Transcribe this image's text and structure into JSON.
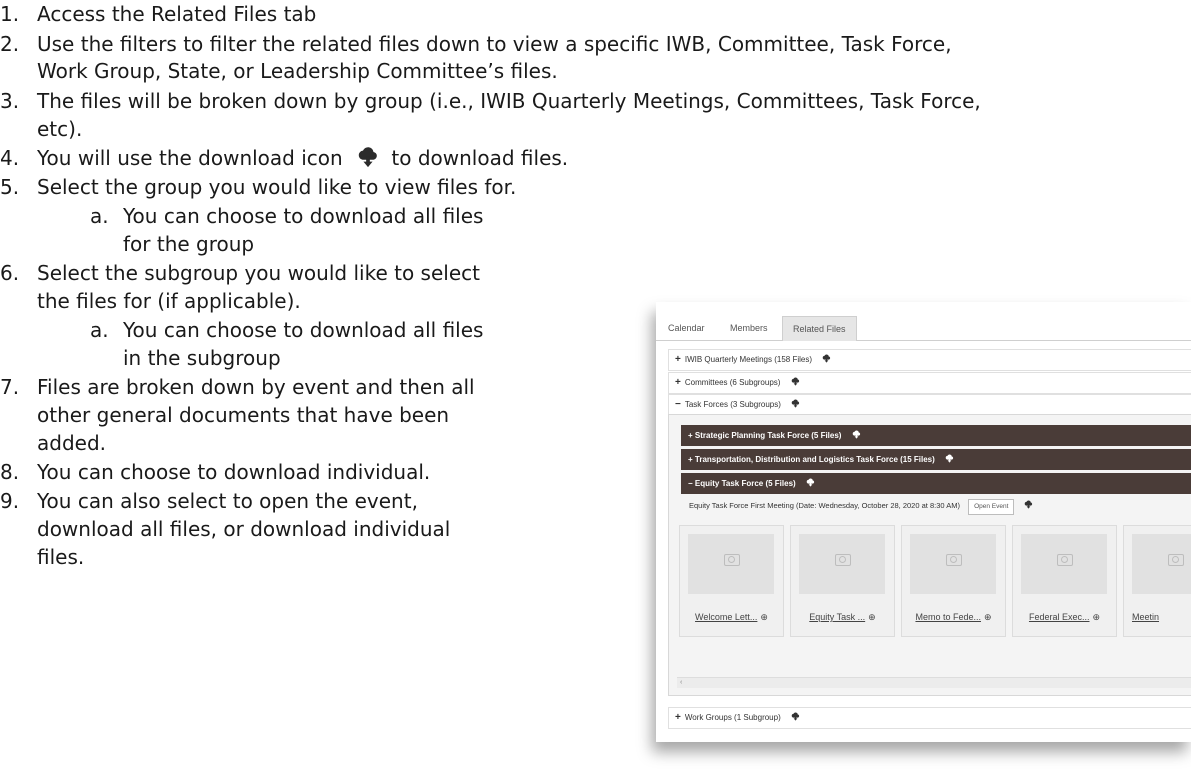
{
  "doc": {
    "items": [
      {
        "num": "1.",
        "text": "Access the Related Files tab"
      },
      {
        "num": "2.",
        "text": "Use the filters to filter the related files down to view a specific IWB, Committee, Task Force,",
        "cont": "Work Group, State, or Leadership Committee’s files."
      },
      {
        "num": "3.",
        "text": "The files will be broken down by group (i.e., IWIB Quarterly Meetings, Committees, Task Force,",
        "cont": "etc)."
      },
      {
        "num": "4.",
        "text_before": "You will use the download icon",
        "text_after": "to download files."
      },
      {
        "num": "5.",
        "text": "Select the group you would like to view files for."
      },
      {
        "num": "a.",
        "line1": "You can choose to download all files",
        "line2": "for the group"
      },
      {
        "num": "6.",
        "line1": "Select the subgroup you would like to select",
        "line2": "the files for (if applicable)."
      },
      {
        "num": "a.",
        "line1": "You can choose to download all files",
        "line2": "in the subgroup"
      },
      {
        "num": "7.",
        "line1": "Files are broken down by event and then all",
        "line2": "other general documents that have been",
        "line3": "added."
      },
      {
        "num": "8.",
        "text": "You can choose to download individual."
      },
      {
        "num": "9.",
        "line1": "You can also select to open the event,",
        "line2": "download all files, or download individual",
        "line3": "files."
      }
    ]
  },
  "screenshot": {
    "tabs": [
      "Calendar",
      "Members",
      "Related Files"
    ],
    "groups": [
      {
        "sign": "+",
        "label": "IWIB Quarterly Meetings  (158 Files)"
      },
      {
        "sign": "+",
        "label": "Committees  (6 Subgroups)"
      },
      {
        "sign": "−",
        "label": "Task Forces  (3 Subgroups)"
      },
      {
        "sign": "+",
        "label": "Work Groups  (1 Subgroup)"
      }
    ],
    "subgroups": [
      {
        "sign": "+",
        "label": "Strategic Planning Task Force  (5 Files)"
      },
      {
        "sign": "+",
        "label": "Transportation, Distribution and Logistics Task Force  (15 Files)"
      },
      {
        "sign": "−",
        "label": "Equity Task Force  (5 Files)"
      }
    ],
    "event": {
      "label": "Equity Task Force First Meeting (Date: Wednesday, October 28, 2020 at 8:30 AM)",
      "open_button": "Open Event"
    },
    "files": [
      "Welcome Lett...",
      "Equity Task ...",
      "Memo to Fede...",
      "Federal Exec...",
      "Meetin"
    ],
    "file_action_glyph": "⊕",
    "scroll_arrow": "‹"
  },
  "colors": {
    "subgroup_bar": "#4a3c38",
    "active_tab": "#e6e6e6"
  },
  "icons": [
    "cloud-download-icon",
    "camera-placeholder-icon",
    "plus-circle-icon"
  ]
}
